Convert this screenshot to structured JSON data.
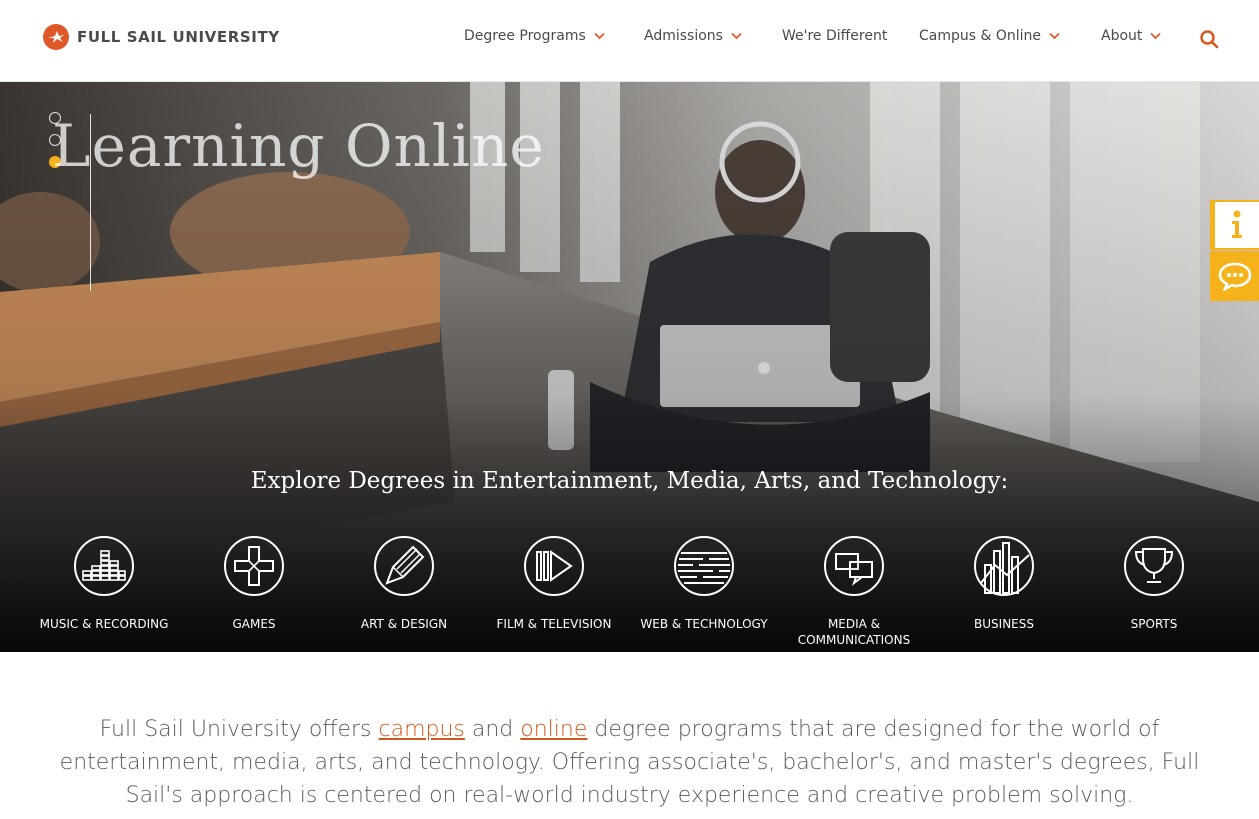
{
  "brand": {
    "name": "FULL SAIL UNIVERSITY",
    "accent": "#e0582a",
    "yellow": "#f5b21a"
  },
  "nav": {
    "items": [
      {
        "label": "Degree Programs",
        "dropdown": true
      },
      {
        "label": "Admissions",
        "dropdown": true
      },
      {
        "label": "We're Different",
        "dropdown": false
      },
      {
        "label": "Campus & Online",
        "dropdown": true
      },
      {
        "label": "About",
        "dropdown": true
      }
    ],
    "search_icon": "search-icon"
  },
  "hero": {
    "title": "Learning Online",
    "slides": 3,
    "active_slide": 3,
    "explore_heading": "Explore Degrees in Entertainment, Media, Arts, and Technology:",
    "categories": [
      {
        "label": "MUSIC & RECORDING",
        "icon": "music-recording-icon"
      },
      {
        "label": "GAMES",
        "icon": "games-icon"
      },
      {
        "label": "ART & DESIGN",
        "icon": "art-design-icon"
      },
      {
        "label": "FILM & TELEVISION",
        "icon": "film-television-icon"
      },
      {
        "label": "WEB & TECHNOLOGY",
        "icon": "web-technology-icon"
      },
      {
        "label": "MEDIA & COMMUNICATIONS",
        "icon": "media-communications-icon"
      },
      {
        "label": "BUSINESS",
        "icon": "business-icon"
      },
      {
        "label": "SPORTS",
        "icon": "sports-icon"
      }
    ]
  },
  "side_tabs": {
    "info_icon": "info-icon",
    "chat_icon": "chat-icon"
  },
  "intro": {
    "part1": "Full Sail University offers ",
    "link_campus": "campus",
    "part2": " and ",
    "link_online": "online",
    "part3": " degree programs that are designed for the world of entertainment, media, arts, and technology. Offering associate's, bachelor's, and master's degrees, Full Sail's approach is centered on real-world industry experience and creative problem solving."
  }
}
